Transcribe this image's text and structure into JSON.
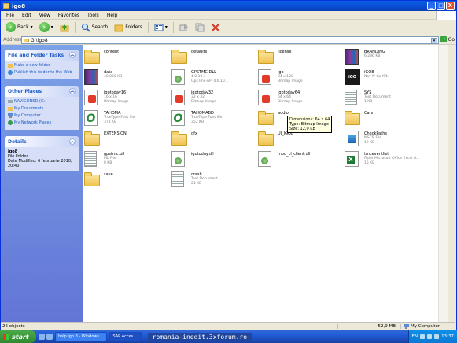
{
  "window": {
    "title": "igo8",
    "buttons": [
      "_",
      "□",
      "X"
    ]
  },
  "menu": [
    "File",
    "Edit",
    "View",
    "Favorites",
    "Tools",
    "Help"
  ],
  "toolbar": {
    "back_label": "Back",
    "search_label": "Search",
    "folders_label": "Folders"
  },
  "address": {
    "label": "Address",
    "value": "G:\\igo8",
    "go_label": "Go"
  },
  "tasks": {
    "file_folder_tasks": {
      "title": "File and Folder Tasks",
      "items": [
        "Make a new folder",
        "Publish this folder to the Web"
      ]
    },
    "other_places": {
      "title": "Other Places",
      "items": [
        "NAVIGONSD (G:)",
        "My Documents",
        "My Computer",
        "My Network Places"
      ]
    },
    "details": {
      "title": "Details",
      "name": "igo8",
      "type": "File Folder",
      "modified": "Date Modified: 6 februarie 2010, 20:40"
    }
  },
  "files": [
    {
      "name": "content",
      "sub1": "",
      "sub2": "",
      "icon": "folder"
    },
    {
      "name": "defaults",
      "sub1": "",
      "sub2": "",
      "icon": "folder"
    },
    {
      "name": "license",
      "sub1": "",
      "sub2": "",
      "icon": "folder"
    },
    {
      "name": "BRANDING",
      "sub1": "6.286 KB",
      "sub2": "",
      "icon": "archive"
    },
    {
      "name": "data",
      "sub1": "40.058 KB",
      "sub2": "",
      "icon": "archive"
    },
    {
      "name": "GPSTMC.DLL",
      "sub1": "4.0.10.1",
      "sub2": "GpsTmc-API 4.0.10.1",
      "icon": "dll"
    },
    {
      "name": "igo",
      "sub1": "84 x 100",
      "sub2": "Bitmap Image",
      "icon": "bitmap"
    },
    {
      "name": "iGO8",
      "sub1": "Nav-N-Go Kft.",
      "sub2": "",
      "icon": "app"
    },
    {
      "name": "igotoday16",
      "sub1": "16 x 16",
      "sub2": "Bitmap Image",
      "icon": "bitmap"
    },
    {
      "name": "igotoday32",
      "sub1": "32 x 32",
      "sub2": "Bitmap Image",
      "icon": "bitmap"
    },
    {
      "name": "igotoday64",
      "sub1": "64 x 64",
      "sub2": "Bitmap Image",
      "icon": "bitmap"
    },
    {
      "name": "SYS",
      "sub1": "Text Document",
      "sub2": "1 KB",
      "icon": "text"
    },
    {
      "name": "TAHOMA",
      "sub1": "TrueType Font file",
      "sub2": "378 KB",
      "icon": "font"
    },
    {
      "name": "TAHOMABD",
      "sub1": "TrueType Font file",
      "sub2": "352 KB",
      "icon": "font"
    },
    {
      "name": "audio",
      "sub1": "",
      "sub2": "",
      "icon": "folder"
    },
    {
      "name": "Cars",
      "sub1": "",
      "sub2": "",
      "icon": "folder"
    },
    {
      "name": "EXTENSION",
      "sub1": "",
      "sub2": "",
      "icon": "folder"
    },
    {
      "name": "gfx",
      "sub1": "",
      "sub2": "",
      "icon": "folder"
    },
    {
      "name": "UI_IGO8",
      "sub1": "",
      "sub2": "",
      "icon": "folder"
    },
    {
      "name": "CheckPaths",
      "sub1": "MSCR File",
      "sub2": "12 KB",
      "icon": "mscr"
    },
    {
      "name": "gpstmc.pil",
      "sub1": "PIL File",
      "sub2": "8 KB",
      "icon": "text"
    },
    {
      "name": "igotoday.dll",
      "sub1": "",
      "sub2": "",
      "icon": "dll"
    },
    {
      "name": "mod_cl_client.dll",
      "sub1": "",
      "sub2": "",
      "icon": "dll"
    },
    {
      "name": "tmceventlist",
      "sub1": "Fișier Microsoft Office Excel d...",
      "sub2": "15 KB",
      "icon": "excel"
    },
    {
      "name": "save",
      "sub1": "",
      "sub2": "",
      "icon": "folder"
    },
    {
      "name": "crash",
      "sub1": "Text Document",
      "sub2": "21 KB",
      "icon": "text"
    }
  ],
  "tooltip": {
    "line1": "Dimensions: 64 x 64",
    "line2": "Type: Bitmap Image",
    "line3": "Size: 12,0 KB"
  },
  "status": {
    "objects": "26 objects",
    "size": "52,9 MB",
    "location": "My Computer"
  },
  "taskbar": {
    "start": "start",
    "buttons": [
      "help igo 8 - Windows ...",
      "SAP Acces ..."
    ],
    "url": "romania-inedit.3xforum.ro",
    "lang": "EN",
    "time": "13:37"
  }
}
